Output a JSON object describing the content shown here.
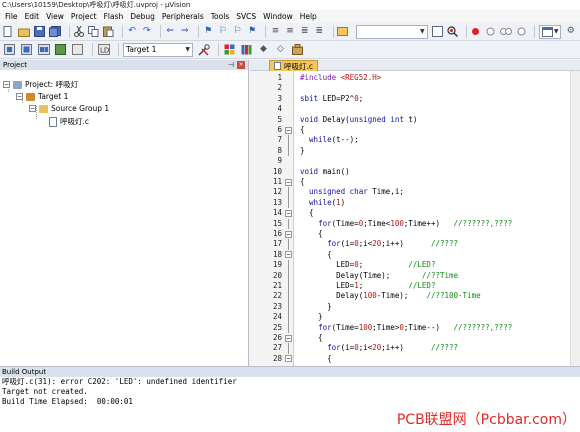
{
  "window": {
    "title": "C:\\Users\\10159\\Desktop\\呼吸灯\\呼吸灯.uvproj - µVision"
  },
  "menu": [
    "File",
    "Edit",
    "View",
    "Project",
    "Flash",
    "Debug",
    "Peripherals",
    "Tools",
    "SVCS",
    "Window",
    "Help"
  ],
  "toolbar1": {
    "icons": [
      "new-file-icon",
      "open-icon",
      "save-icon",
      "save-all-icon",
      "cut-icon",
      "copy-icon",
      "paste-icon",
      "undo-icon",
      "redo-icon",
      "nav-back-icon",
      "nav-forward-icon",
      "bookmark-icon",
      "bookmark-prev-icon",
      "bookmark-next-icon",
      "bookmark-clear-icon",
      "indent-icon",
      "unindent-icon",
      "comment-icon",
      "uncomment-icon",
      "find-in-files-icon"
    ],
    "right_icons": [
      "find-icon",
      "debug-session-icon",
      "breakpoint-icon",
      "breakpoint-disable-icon",
      "breakpoint-kill-icon",
      "view-window-icon",
      "config-icon"
    ]
  },
  "toolbar2": {
    "target_label": "Target 1",
    "icons": [
      "translate-icon",
      "build-icon",
      "rebuild-icon",
      "batch-build-icon",
      "stop-build-icon",
      "download-icon"
    ]
  },
  "project_panel": {
    "title": "Project",
    "items": [
      {
        "label": "Project: 呼吸灯",
        "type": "project"
      },
      {
        "label": "Target 1",
        "type": "target"
      },
      {
        "label": "Source Group 1",
        "type": "group"
      },
      {
        "label": "呼吸灯.c",
        "type": "file"
      }
    ]
  },
  "editor": {
    "tab_label": "呼吸灯.c",
    "lines": [
      {
        "n": "1",
        "code": "#include <REG52.H>"
      },
      {
        "n": "2",
        "code": ""
      },
      {
        "n": "3",
        "code": "sbit LED=P2^0;"
      },
      {
        "n": "4",
        "code": ""
      },
      {
        "n": "5",
        "code": "void Delay(unsigned int t)"
      },
      {
        "n": "6",
        "code": "{"
      },
      {
        "n": "7",
        "code": "  while(t--);"
      },
      {
        "n": "8",
        "code": "}"
      },
      {
        "n": "9",
        "code": ""
      },
      {
        "n": "10",
        "code": "void main()"
      },
      {
        "n": "11",
        "code": "{"
      },
      {
        "n": "12",
        "code": "  unsigned char Time,i;"
      },
      {
        "n": "13",
        "code": "  while(1)"
      },
      {
        "n": "14",
        "code": "  {"
      },
      {
        "n": "15",
        "code": "    for(Time=0;Time<100;Time++)   //??????,????"
      },
      {
        "n": "16",
        "code": "    {"
      },
      {
        "n": "17",
        "code": "      for(i=0;i<20;i++)      //????"
      },
      {
        "n": "18",
        "code": "      {"
      },
      {
        "n": "19",
        "code": "        LED=0;          //LED?"
      },
      {
        "n": "20",
        "code": "        Delay(Time);       //??Time"
      },
      {
        "n": "21",
        "code": "        LED=1;          //LED?"
      },
      {
        "n": "22",
        "code": "        Delay(100-Time);    //??100-Time"
      },
      {
        "n": "23",
        "code": "      }"
      },
      {
        "n": "24",
        "code": "    }"
      },
      {
        "n": "25",
        "code": "    for(Time=100;Time>0;Time--)   //??????,????"
      },
      {
        "n": "26",
        "code": "    {"
      },
      {
        "n": "27",
        "code": "      for(i=0;i<20;i++)      //????"
      },
      {
        "n": "28",
        "code": "      {"
      }
    ]
  },
  "build_output": {
    "title": "Build Output",
    "lines": [
      "呼吸灯.c(31): error C202: 'LED': undefined identifier",
      "Target not created.",
      "Build Time Elapsed:  00:00:01"
    ]
  },
  "watermark": "PCB联盟网（Pcbbar.com）"
}
